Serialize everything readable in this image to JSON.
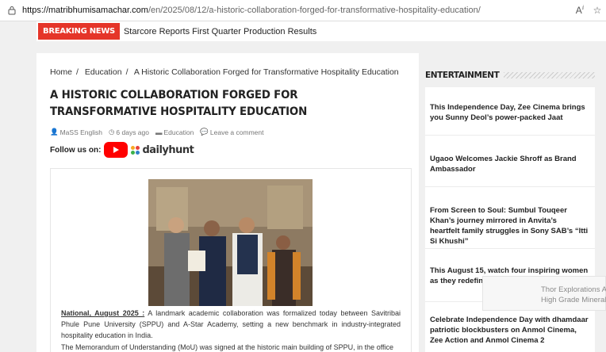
{
  "browser": {
    "url_host": "https://matribhumisamachar.com",
    "url_path": "/en/2025/08/12/a-historic-collaboration-forged-for-transformative-hospitality-education/"
  },
  "breaking": {
    "tag": "BREAKING NEWS",
    "headline": "Starcore Reports First Quarter Production Results"
  },
  "breadcrumb": [
    "Home",
    "Education",
    "A Historic Collaboration Forged for Transformative Hospitality Education"
  ],
  "article": {
    "title": "A Historic Collaboration Forged for Transformative Hospitality Education",
    "author": "MaSS English",
    "time_ago": "6 days ago",
    "category": "Education",
    "comment": "Leave a comment",
    "follow_label": "Follow us on:",
    "dailyhunt": "dailyhunt",
    "dateline": "National, August 2025 :",
    "lead": "A landmark academic collaboration was formalized today between Savitribai Phule Pune University (SPPU) and A-Star Academy, setting a new benchmark in industry-integrated hospitality education in India.",
    "lead2": "The Memorandum of Understanding (MoU) was signed at the historic main building of SPPU, in the office"
  },
  "sidebar": {
    "title": "ENTERTAINMENT",
    "items": [
      "This Independence Day, Zee Cinema brings you Sunny Deol’s power-packed Jaat",
      "Ugaoo Welcomes Jackie Shroff as Brand Ambassador",
      "From Screen to Soul: Sumbul Touqeer Khan’s journey mirrored in Anvita’s heartfelt family struggles in Sony SAB’s “Itti Si Khushi”",
      "This August 15, watch four inspiring women as they redefine independence",
      "Celebrate Independence Day with dhamdaar patriotic blockbusters on Anmol Cinema, Zee Action and Anmol Cinema 2"
    ]
  },
  "popup": {
    "line1": "Thor Explorations An",
    "line2": "High Grade Minerali"
  },
  "colors": {
    "accent": "#e53529",
    "youtube": "#ff0000"
  }
}
